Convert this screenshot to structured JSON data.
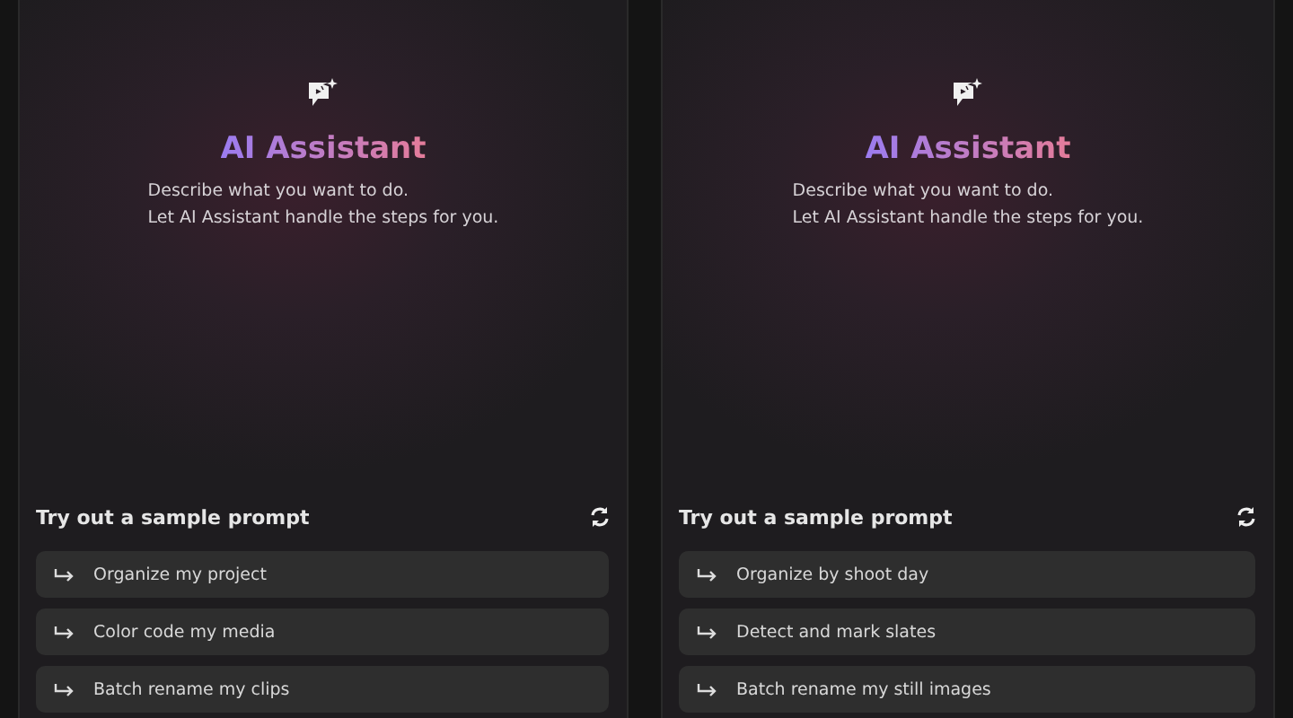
{
  "panels": [
    {
      "title": "AI Assistant",
      "description": [
        "Describe what you want to do.",
        "Let AI Assistant handle the steps for you."
      ],
      "prompts_heading": "Try out a sample prompt",
      "prompts": [
        "Organize my project",
        "Color code my media",
        "Batch rename my clips"
      ]
    },
    {
      "title": "AI Assistant",
      "description": [
        "Describe what you want to do.",
        "Let AI Assistant handle the steps for you."
      ],
      "prompts_heading": "Try out a sample prompt",
      "prompts": [
        "Organize by shoot day",
        "Detect and mark slates",
        "Batch rename my still images"
      ]
    }
  ]
}
